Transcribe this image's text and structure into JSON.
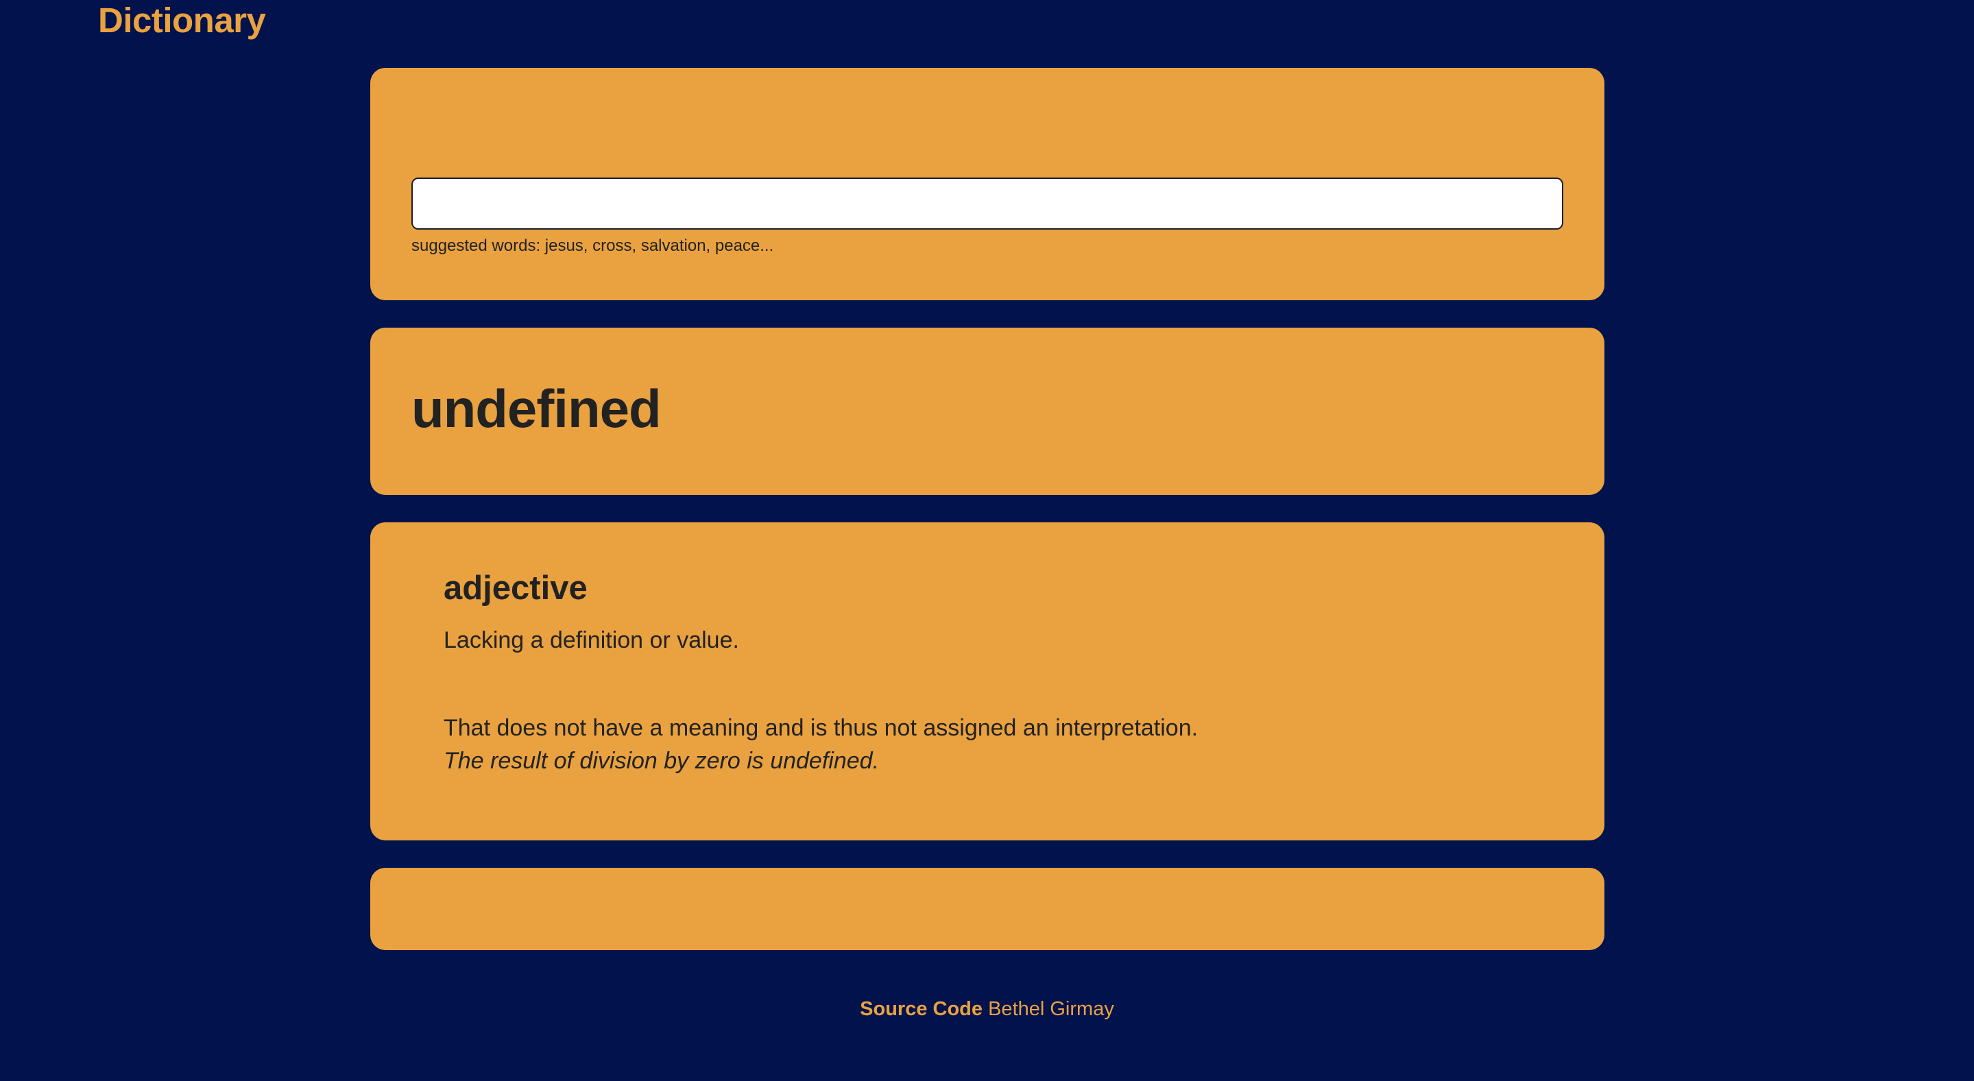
{
  "app": {
    "title": "Dictionary"
  },
  "search": {
    "value": "",
    "placeholder": "",
    "hint": "suggested words: jesus, cross, salvation, peace..."
  },
  "result": {
    "word": "undefined",
    "meaning": {
      "part_of_speech": "adjective",
      "definitions": [
        {
          "text": "Lacking a definition or value."
        },
        {
          "text": "That does not have a meaning and is thus not assigned an interpretation.",
          "example": "The result of division by zero is undefined."
        }
      ]
    }
  },
  "footer": {
    "source_label": "Source Code",
    "author": "Bethel Girmay"
  },
  "colors": {
    "background": "#01124D",
    "card": "#E9A23F",
    "text": "#222222"
  }
}
